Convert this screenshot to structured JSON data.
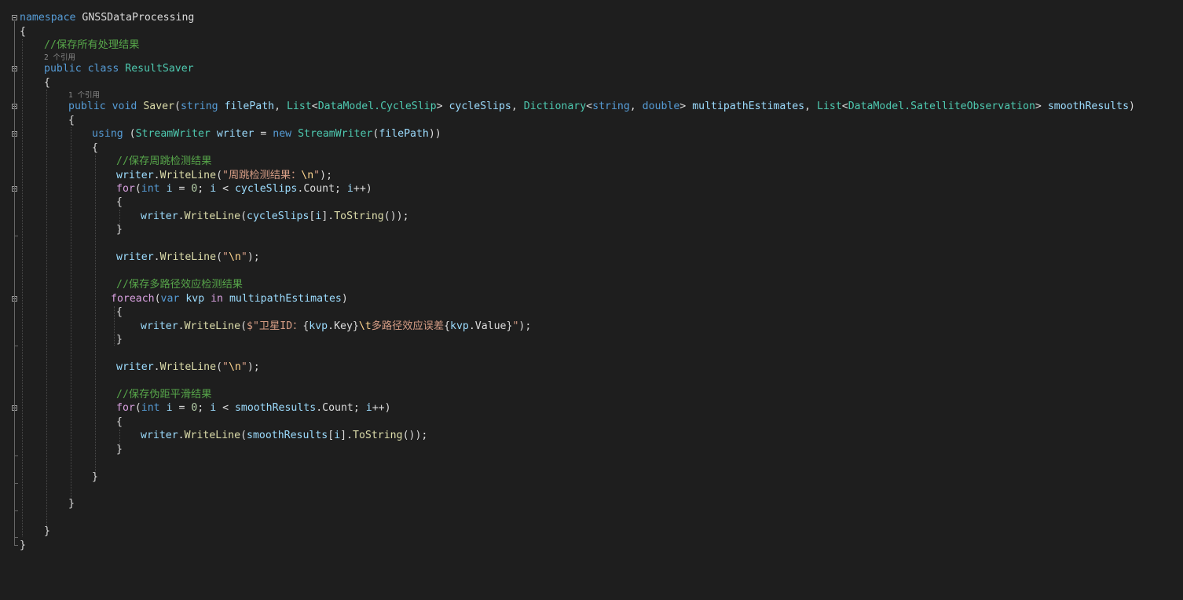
{
  "editor": {
    "lines": {
      "l1": {
        "kw": "namespace",
        "name": "GNSSDataProcessing"
      },
      "l2": "{",
      "l3": "//保存所有处理结果",
      "l4": "2 个引用",
      "l5": {
        "kw1": "public",
        "kw2": "class",
        "name": "ResultSaver"
      },
      "l6": "{",
      "l7": "1 个引用",
      "l8": {
        "kw1": "public",
        "kw2": "void",
        "fn": "Saver",
        "open": "(",
        "t1": "string",
        "p1": "filePath",
        "c1": ", ",
        "t2": "List",
        "lt2": "<",
        "t2a": "DataModel.CycleSlip",
        "gt2": ">",
        "p2": "cycleSlips",
        "c2": ", ",
        "t3": "Dictionary",
        "lt3": "<",
        "t3a": "string",
        "c3a": ", ",
        "t3b": "double",
        "gt3": ">",
        "p3": "multipathEstimates",
        "c3": ", ",
        "t4": "List",
        "lt4": "<",
        "t4a": "DataModel.SatelliteObservation",
        "gt4": ">",
        "p4": "smoothResults",
        "close": ")"
      },
      "l9": "{",
      "l10": {
        "kw": "using",
        "open": " (",
        "ty": "StreamWriter",
        "var": "writer",
        "eq": " = ",
        "kw2": "new",
        "ty2": "StreamWriter",
        "open2": "(",
        "arg": "filePath",
        "close": "))"
      },
      "l11": "{",
      "l12": "//保存周跳检测结果",
      "l13": {
        "obj": "writer",
        "dot": ".",
        "fn": "WriteLine",
        "open": "(",
        "str": "\"周跳检测结果：",
        "esc": "\\n",
        "strEnd": "\"",
        "close": ");"
      },
      "l14": {
        "kw": "for",
        "open": "(",
        "kw2": "int",
        "v1": "i",
        "a1": " = ",
        "n": "0",
        "a2": "; ",
        "v2": "i",
        "a3": " < ",
        "obj": "cycleSlips",
        "dot": ".",
        "prop": "Count",
        "a4": "; ",
        "v3": "i",
        "close": "++)"
      },
      "l15": "{",
      "l16": {
        "obj": "writer",
        "dot": ".",
        "fn": "WriteLine",
        "open": "(",
        "arg": "cycleSlips",
        "br": "[",
        "idx": "i",
        "br2": "].",
        "fn2": "ToString",
        "close": "());"
      },
      "l17": "}",
      "l18": {
        "obj": "writer",
        "dot": ".",
        "fn": "WriteLine",
        "open": "(",
        "str": "\"",
        "esc": "\\n",
        "strEnd": "\"",
        "close": ");"
      },
      "l19": "//保存多路径效应检测结果",
      "l20": {
        "kw": "foreach",
        "open": "(",
        "kw2": "var",
        "v": "kvp",
        "kw3": "in",
        "arg": "multipathEstimates",
        "close": ")"
      },
      "l21": "{",
      "l22": {
        "obj": "writer",
        "dot": ".",
        "fn": "WriteLine",
        "open": "(",
        "s1": "$\"卫星ID：",
        "b1": "{",
        "v1": "kvp",
        "d1": ".",
        "p1": "Key",
        "b2": "}",
        "esc": "\\t",
        "s2": "多路径效应误差",
        "b3": "{",
        "v2": "kvp",
        "d2": ".",
        "p2": "Value",
        "b4": "}",
        "s3": "\"",
        "close": ");"
      },
      "l23": "}",
      "l24": {
        "obj": "writer",
        "dot": ".",
        "fn": "WriteLine",
        "open": "(",
        "str": "\"",
        "esc": "\\n",
        "strEnd": "\"",
        "close": ");"
      },
      "l25": "//保存伪距平滑结果",
      "l26": {
        "kw": "for",
        "open": "(",
        "kw2": "int",
        "v1": "i",
        "a1": " = ",
        "n": "0",
        "a2": "; ",
        "v2": "i",
        "a3": " < ",
        "obj": "smoothResults",
        "dot": ".",
        "prop": "Count",
        "a4": "; ",
        "v3": "i",
        "close": "++)"
      },
      "l27": "{",
      "l28": {
        "obj": "writer",
        "dot": ".",
        "fn": "WriteLine",
        "open": "(",
        "arg": "smoothResults",
        "br": "[",
        "idx": "i",
        "br2": "].",
        "fn2": "ToString",
        "close": "());"
      },
      "l29": "}",
      "l30": "}",
      "l31": "}",
      "l32": "}",
      "l33": "}"
    },
    "colors": {
      "background": "#1e1e1e",
      "keyword": "#569cd6",
      "control": "#d8a0df",
      "type": "#4ec9b0",
      "function": "#dcdcaa",
      "variable": "#9cdcfe",
      "string": "#d69d85",
      "comment": "#57a64a",
      "number": "#b5cea8"
    }
  }
}
